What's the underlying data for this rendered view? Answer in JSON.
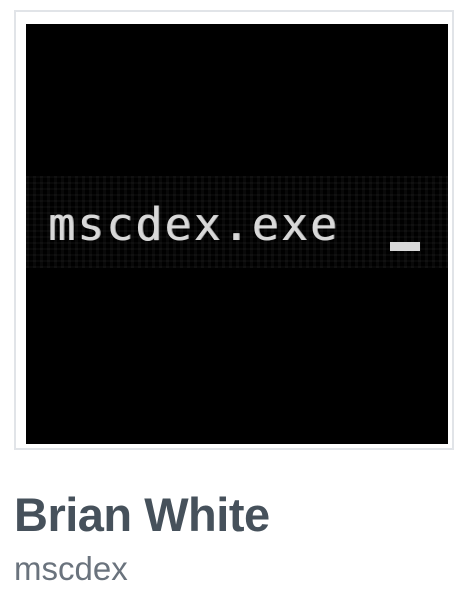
{
  "profile": {
    "avatar_text": "mscdex.exe",
    "full_name": "Brian White",
    "username": "mscdex"
  },
  "colors": {
    "avatar_background": "#000000",
    "avatar_text": "#d9d9d9",
    "full_name": "#46515b",
    "username": "#6a737d",
    "frame_border": "#e1e4e8"
  }
}
